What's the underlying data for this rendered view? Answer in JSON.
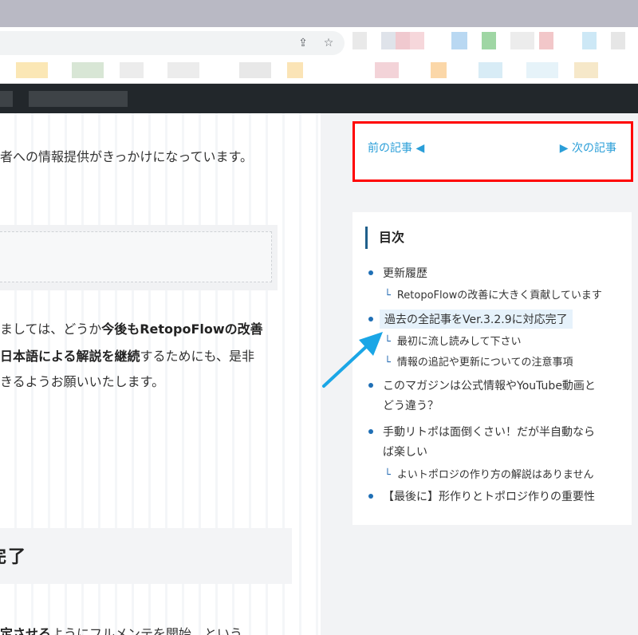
{
  "browser": {
    "icons": [
      "share-icon",
      "star-icon"
    ],
    "icon_glyphs": {
      "share": "⇪",
      "star": "☆"
    }
  },
  "sidebar": {
    "nav": {
      "prev_label": "前の記事 ◀",
      "next_label": "▶ 次の記事",
      "border_color": "#ff0000"
    },
    "toc": {
      "title": "目次",
      "items": [
        {
          "label": "更新履歴",
          "subs": [
            "RetopoFlowの改善に大きく貢献しています"
          ]
        },
        {
          "label": "過去の全記事をVer.3.2.9に対応完了",
          "highlighted": true,
          "subs": [
            "最初に流し読みして下さい",
            "情報の追記や更新についての注意事項"
          ]
        },
        {
          "label_lines": [
            "このマガジンは公式情報やYouTube動画と",
            "どう違う？"
          ],
          "subs": []
        },
        {
          "label_lines": [
            "手動リトポは面倒くさい！だが半自動なら",
            "ば楽しい"
          ],
          "subs": [
            "よいトポロジの作り方の解説はありません"
          ]
        },
        {
          "label": "【最後に】形作りとトポロジ作りの重要性",
          "subs": []
        }
      ],
      "sub_mark": "└"
    }
  },
  "main": {
    "line1": "者への情報提供がきっかけになっています。",
    "para2": [
      {
        "parts": [
          "ましては、どうか",
          "今後もRetopoFlowの改善"
        ]
      },
      {
        "parts": [
          "日本語による解説を継続",
          "するためにも、是非"
        ]
      },
      {
        "parts": [
          "きるようお願いいたします。"
        ]
      }
    ],
    "heading": "完了",
    "bottom_line": [
      "定させる",
      "ようにフルメンテを開始、という"
    ]
  },
  "colors": {
    "accent_link": "#2a9ed8",
    "bullet": "#1f6fb5",
    "arrow": "#1aa6e6",
    "header_bg": "#22272b"
  }
}
